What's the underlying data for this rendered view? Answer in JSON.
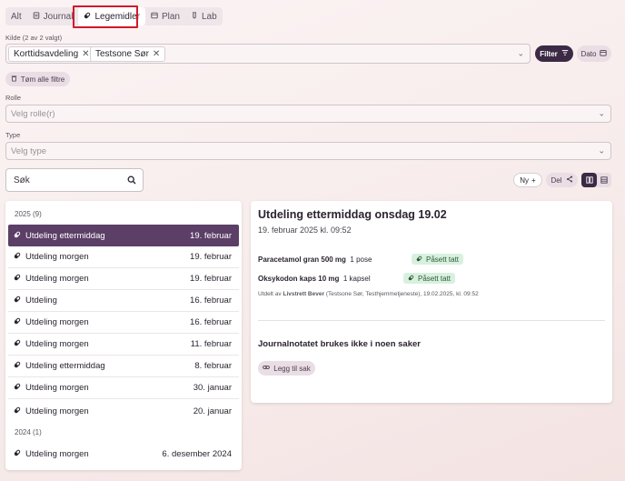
{
  "tabs": [
    {
      "label": "Alt",
      "icon": ""
    },
    {
      "label": "Journal",
      "icon": "journal-icon"
    },
    {
      "label": "Legemidler",
      "icon": "pill-icon"
    },
    {
      "label": "Plan",
      "icon": "plan-icon"
    },
    {
      "label": "Lab",
      "icon": "lab-icon"
    }
  ],
  "active_tab": "Legemidler",
  "source": {
    "label": "Kilde (2 av 2 valgt)",
    "chips": [
      "Korttidsavdeling",
      "Testsone Sør"
    ]
  },
  "filter_button": "Filter",
  "date_button": "Dato",
  "clear_filters": "Tøm alle filtre",
  "role": {
    "label": "Rolle",
    "placeholder": "Velg rolle(r)"
  },
  "type": {
    "label": "Type",
    "placeholder": "Velg type"
  },
  "search": {
    "placeholder": "Søk"
  },
  "new_button": "Ny",
  "share_button": "Del",
  "list": {
    "groups": [
      {
        "year": "2025 (9)"
      },
      {
        "year": "2024 (1)"
      }
    ],
    "items": [
      {
        "title": "Utdeling ettermiddag",
        "date": "19. februar"
      },
      {
        "title": "Utdeling morgen",
        "date": "19. februar"
      },
      {
        "title": "Utdeling morgen",
        "date": "19. februar"
      },
      {
        "title": "Utdeling",
        "date": "16. februar"
      },
      {
        "title": "Utdeling morgen",
        "date": "16. februar"
      },
      {
        "title": "Utdeling morgen",
        "date": "11. februar"
      },
      {
        "title": "Utdeling ettermiddag",
        "date": "8. februar"
      },
      {
        "title": "Utdeling morgen",
        "date": "30. januar"
      },
      {
        "title": "Utdeling morgen",
        "date": "20. januar"
      },
      {
        "title": "Utdeling morgen",
        "date": "6. desember 2024"
      }
    ],
    "selected_index": 0
  },
  "detail": {
    "title": "Utdeling ettermiddag onsdag 19.02",
    "datetime": "19. februar 2025 kl. 09:52",
    "medications": [
      {
        "name": "Paracetamol gran 500 mg",
        "dose": "1 pose",
        "status": "Påsett tatt"
      },
      {
        "name": "Oksykodon kaps 10 mg",
        "dose": "1 kapsel",
        "status": "Påsett tatt"
      }
    ],
    "dispensed_prefix": "Utdelt av",
    "dispensed_by": "Livstrett Bever",
    "dispensed_rest": "(Testsone Sør, Testhjemmetjeneste), 19.02.2025, kl. 09:52",
    "journal_note": "Journalnotatet brukes ikke i noen saker",
    "add_case_button": "Legg til sak"
  },
  "colors": {
    "accent_dark": "#3c2a45",
    "selected_row": "#5b3f66",
    "badge_bg": "#d8f1df",
    "highlight": "#d11a2a"
  }
}
